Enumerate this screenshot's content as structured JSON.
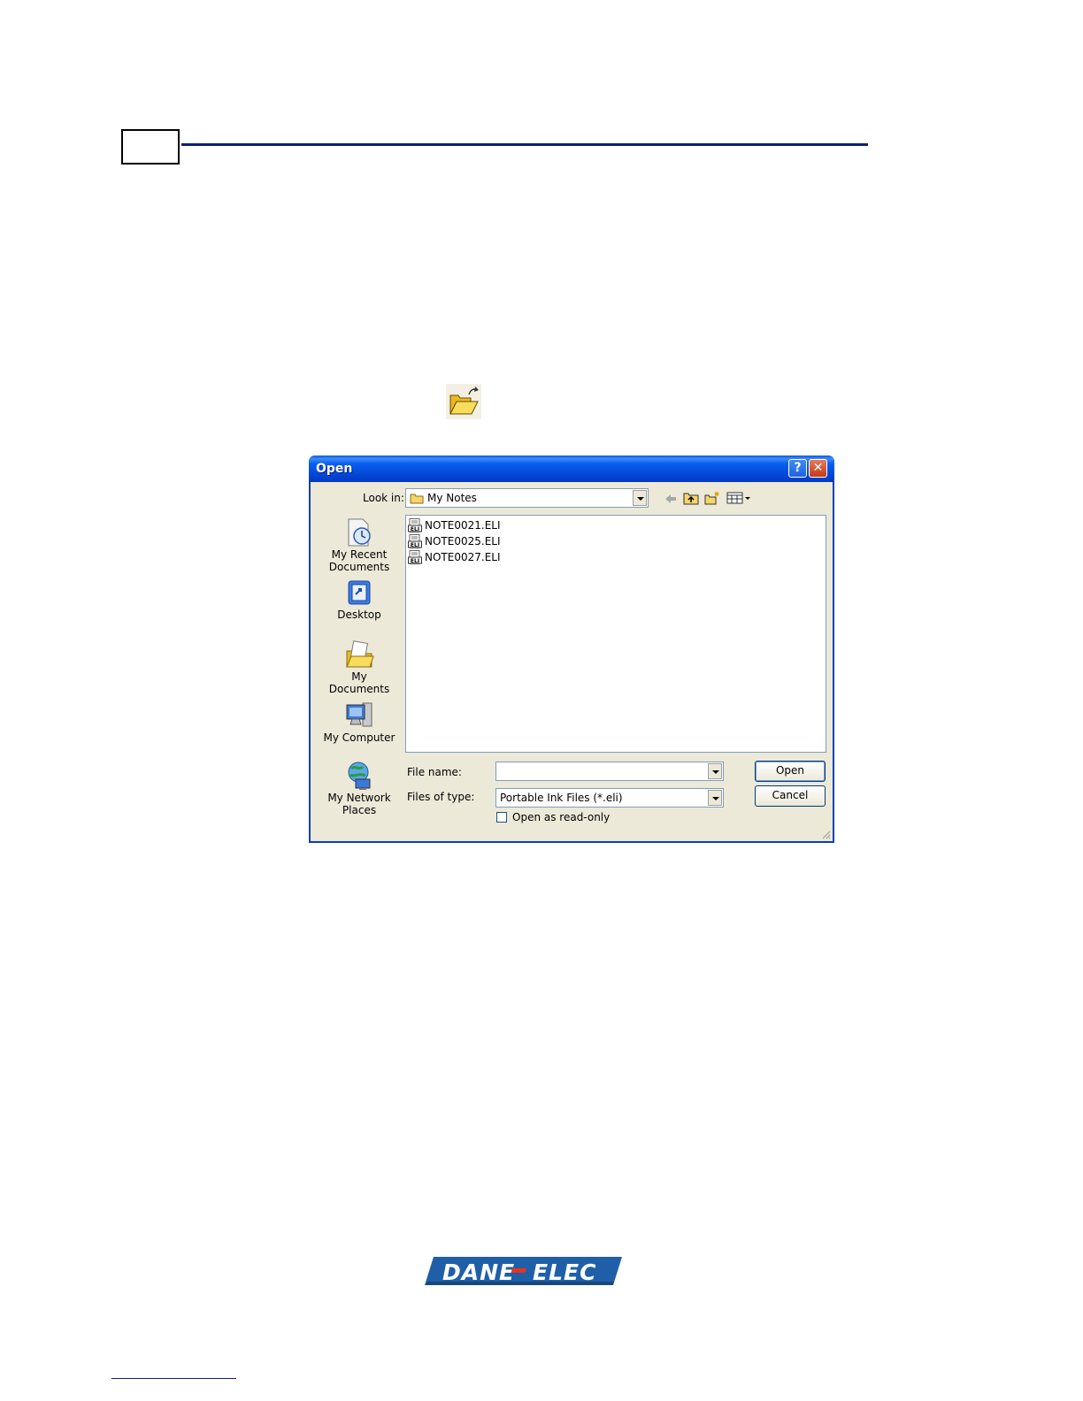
{
  "dialog": {
    "title": "Open",
    "help_button": "?",
    "close_button": "✕",
    "look_in_label": "Look in:",
    "look_in_value": "My Notes",
    "places": [
      {
        "label": "My Recent\nDocuments",
        "icon": "recent-documents-icon"
      },
      {
        "label": "Desktop",
        "icon": "desktop-icon"
      },
      {
        "label": "My Documents",
        "icon": "my-documents-icon"
      },
      {
        "label": "My Computer",
        "icon": "my-computer-icon"
      },
      {
        "label": "My Network\nPlaces",
        "icon": "network-places-icon"
      }
    ],
    "files": [
      "NOTE0021.ELI",
      "NOTE0025.ELI",
      "NOTE0027.ELI"
    ],
    "file_icon_text": "ELI",
    "file_name_label": "File name:",
    "file_name_value": "",
    "files_of_type_label": "Files of type:",
    "files_of_type_value": "Portable Ink Files (*.eli)",
    "read_only_label": "Open as read-only",
    "open_button": "Open",
    "cancel_button": "Cancel"
  },
  "logo": {
    "text": "DANE-ELEC",
    "color": "#1f5fa8",
    "accent": "#e8331c"
  },
  "colors": {
    "header_rule": "#0b1f78",
    "titlebar": "#0a58e6"
  }
}
